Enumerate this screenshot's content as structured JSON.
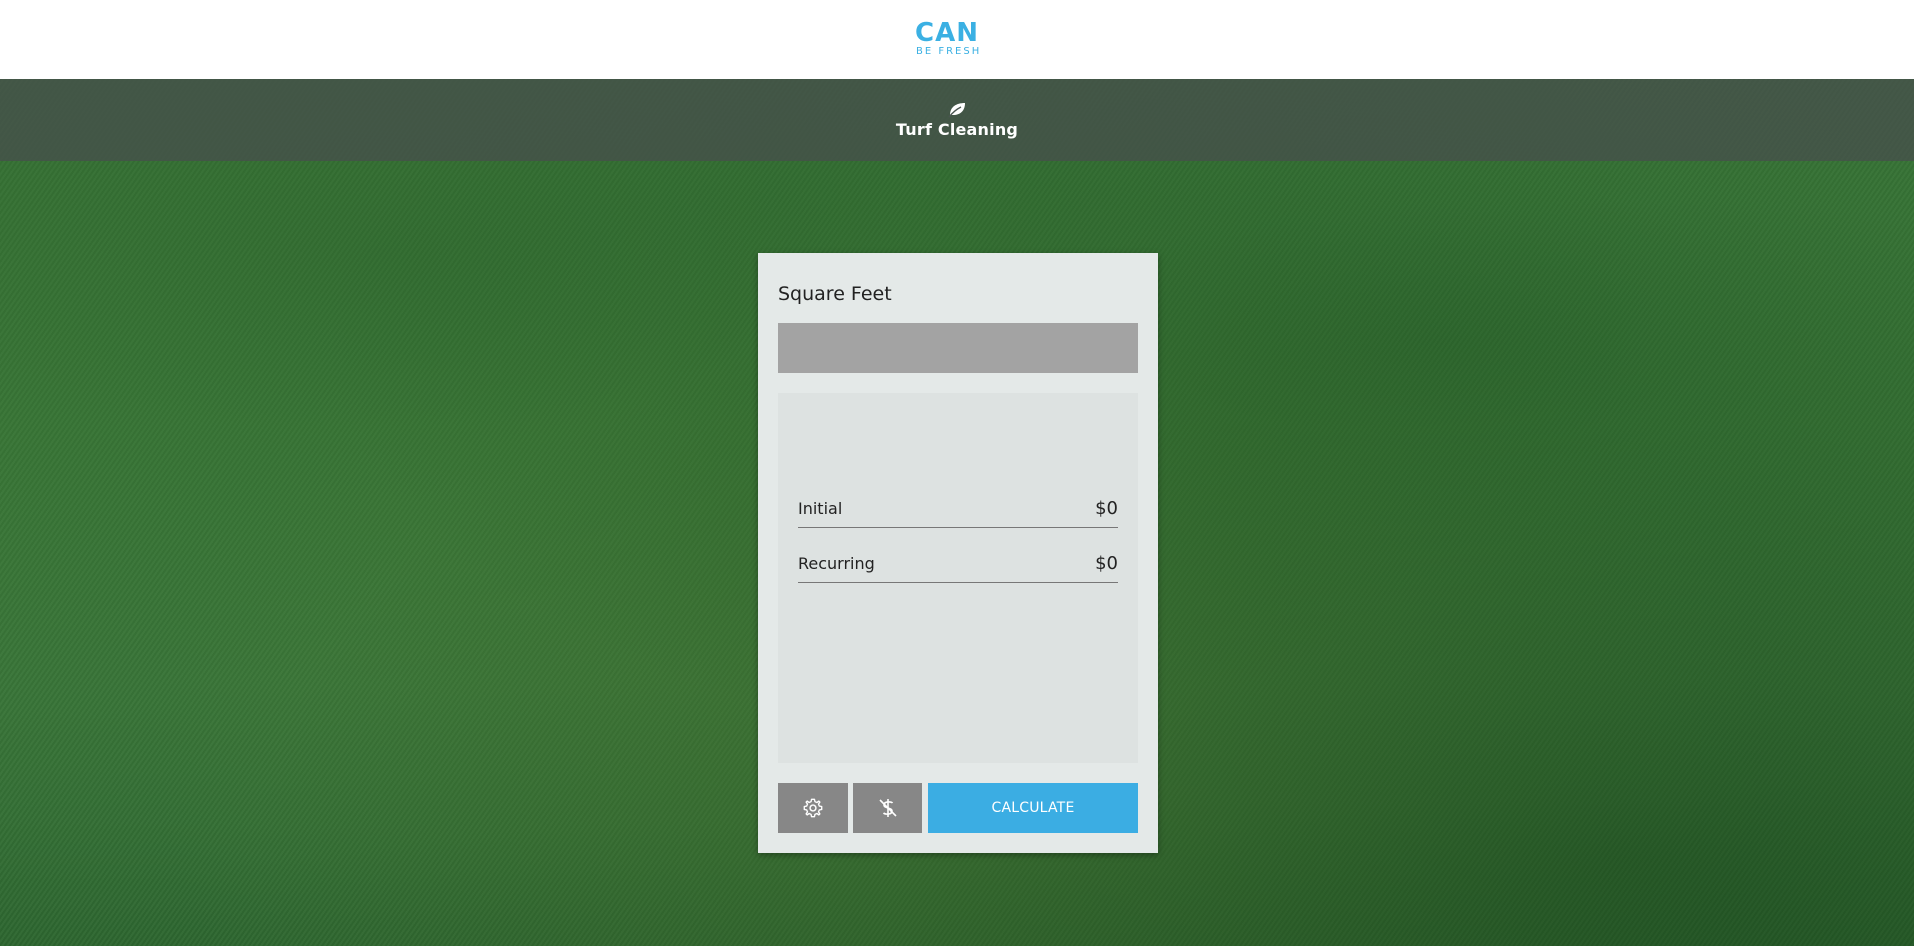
{
  "header": {
    "logo_top": "CAN",
    "logo_bottom": "BE FRESH"
  },
  "banner": {
    "icon": "leaf-icon",
    "title": "Turf Cleaning"
  },
  "calculator": {
    "input_label": "Square Feet",
    "input_value": "",
    "results": [
      {
        "label": "Initial",
        "value": "$0"
      },
      {
        "label": "Recurring",
        "value": "$0"
      }
    ],
    "buttons": {
      "settings_icon": "gear-icon",
      "no_dollar_icon": "dollar-off-icon",
      "calculate_label": "CALCULATE"
    }
  },
  "colors": {
    "brand": "#3bb0e3",
    "button_primary": "#3bade3",
    "button_secondary": "#878787",
    "input_bg": "#a3a3a3",
    "card_bg": "#e4e9e8"
  }
}
